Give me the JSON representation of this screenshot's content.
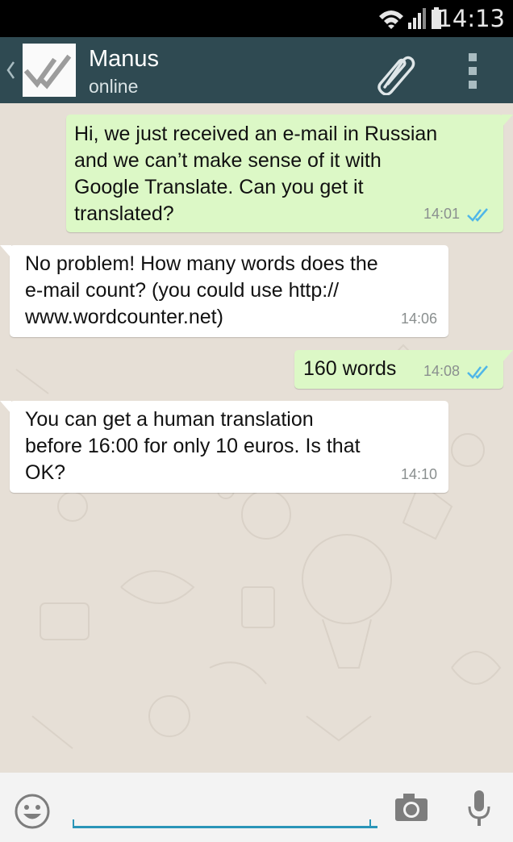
{
  "status_bar": {
    "time": "14:13"
  },
  "header": {
    "contact_name": "Manus",
    "contact_status": "online"
  },
  "messages": [
    {
      "direction": "out",
      "text": "Hi, we just received an e-mail in Russian\nand we can’t make sense of it with\nGoogle Translate. Can you get it\ntranslated?",
      "time": "14:01",
      "read": true
    },
    {
      "direction": "in",
      "text": "No problem! How many words does the\ne-mail count? (you could use http://\nwww.wordcounter.net)",
      "time": "14:06"
    },
    {
      "direction": "out",
      "text": "160 words",
      "time": "14:08",
      "read": true
    },
    {
      "direction": "in",
      "text": "You can get a human translation\nbefore 16:00 for only 10 euros. Is that\nOK?",
      "time": "14:10"
    }
  ],
  "input": {
    "placeholder": "",
    "value": ""
  },
  "colors": {
    "header": "#2f4a52",
    "outgoing_bubble": "#dcf8c6",
    "incoming_bubble": "#ffffff",
    "read_tick": "#4fb6e8",
    "input_underline": "#2a95b8"
  },
  "icons": {
    "back": "chevron-left-icon",
    "avatar": "double-check-avatar",
    "attach": "paperclip-icon",
    "menu": "overflow-menu-icon",
    "emoji": "smiley-icon",
    "camera": "camera-icon",
    "mic": "microphone-icon"
  }
}
